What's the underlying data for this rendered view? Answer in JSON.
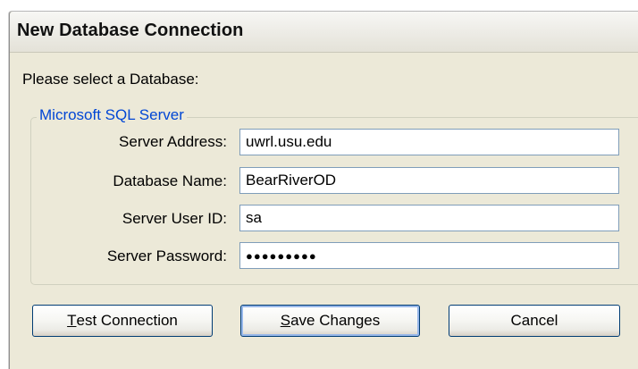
{
  "window": {
    "title": "New Database Connection"
  },
  "prompt": "Please select a Database:",
  "group": {
    "legend": "Microsoft SQL Server",
    "fields": [
      {
        "label": "Server Address:",
        "value": "uwrl.usu.edu"
      },
      {
        "label": "Database Name:",
        "value": "BearRiverOD"
      },
      {
        "label": "Server User ID:",
        "value": "sa"
      },
      {
        "label": "Server Password:",
        "value": "●●●●●●●●●"
      }
    ]
  },
  "buttons": {
    "test": {
      "mnemonic": "T",
      "rest": "est Connection"
    },
    "save": {
      "mnemonic": "S",
      "rest": "ave Changes"
    },
    "cancel": {
      "label": "Cancel"
    }
  },
  "colors": {
    "dialog_bg": "#ece9d8",
    "group_legend": "#0046d5",
    "input_border": "#7f9db9",
    "button_border": "#003c74"
  }
}
